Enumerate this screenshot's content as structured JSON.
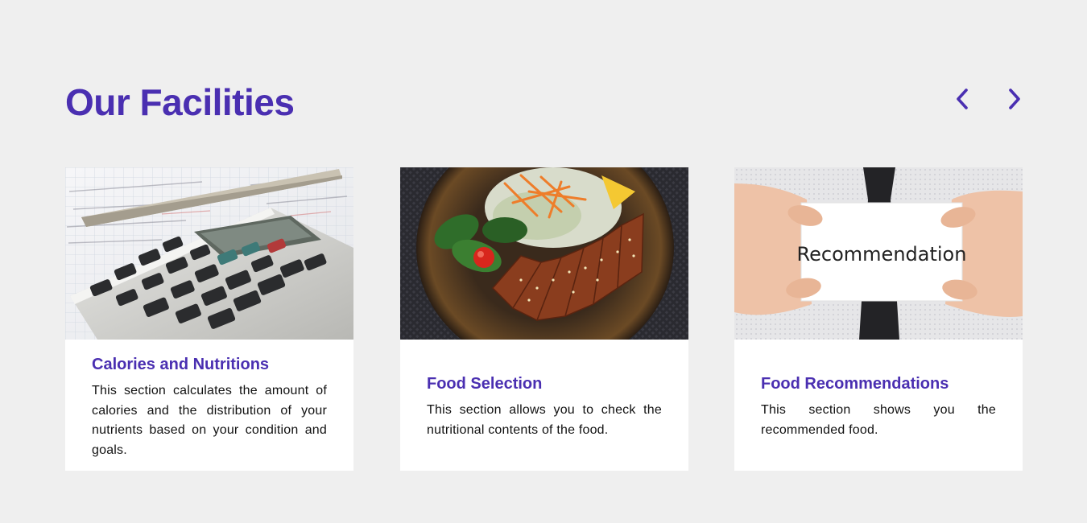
{
  "section": {
    "title": "Our Facilities"
  },
  "carousel": {
    "prev_icon": "chevron-left-icon",
    "next_icon": "chevron-right-icon"
  },
  "colors": {
    "accent": "#4a2fb1",
    "background": "#efefef",
    "card": "#ffffff"
  },
  "cards": [
    {
      "image": "calculator-photo",
      "title": "Calories and Nutritions",
      "text": "This section calculates the amount of calories and the distribution of your nutrients based on your condition and goals."
    },
    {
      "image": "grilled-chicken-salad-photo",
      "title": "Food Selection",
      "text": "This section allows you to check the nutritional contents of the food."
    },
    {
      "image": "recommendation-card-photo",
      "image_text": "Recommendation",
      "title": "Food Recommendations",
      "text": "This section shows you the recommended food."
    }
  ]
}
